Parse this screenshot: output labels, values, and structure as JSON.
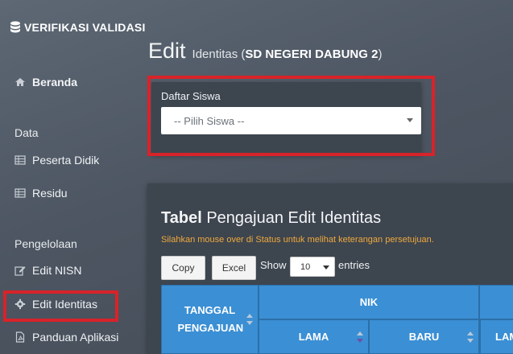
{
  "sidebar": {
    "brand": "VERIFIKASI VALIDASI",
    "items": {
      "beranda": "Beranda",
      "data_section": "Data",
      "peserta": "Peserta Didik",
      "residu": "Residu",
      "pengelolaan_section": "Pengelolaan",
      "edit_nisn": "Edit NISN",
      "edit_identitas": "Edit Identitas",
      "panduan": "Panduan Aplikasi"
    }
  },
  "header": {
    "title": "Edit",
    "subtitle_prefix": "Identitas (",
    "school": "SD NEGERI DABUNG 2",
    "subtitle_suffix": ")"
  },
  "student_select": {
    "label": "Daftar Siswa",
    "value": "-- Pilih Siswa --"
  },
  "table_panel": {
    "title_bold": "Tabel",
    "title_rest": "Pengajuan Edit Identitas",
    "note": "Silahkan mouse over di Status untuk melihat keterangan persetujuan.",
    "copy_label": "Copy",
    "excel_label": "Excel",
    "show_label": "Show",
    "entries_value": "10",
    "entries_label": "entries",
    "headers": {
      "tanggal": "TANGGAL PENGAJUAN",
      "nik": "NIK",
      "lama": "LAMA",
      "baru": "BARU",
      "lama2": "LAMA"
    }
  },
  "colors": {
    "highlight": "#d8232a",
    "table_header": "#3b8fd4",
    "note": "#f0a93c"
  }
}
